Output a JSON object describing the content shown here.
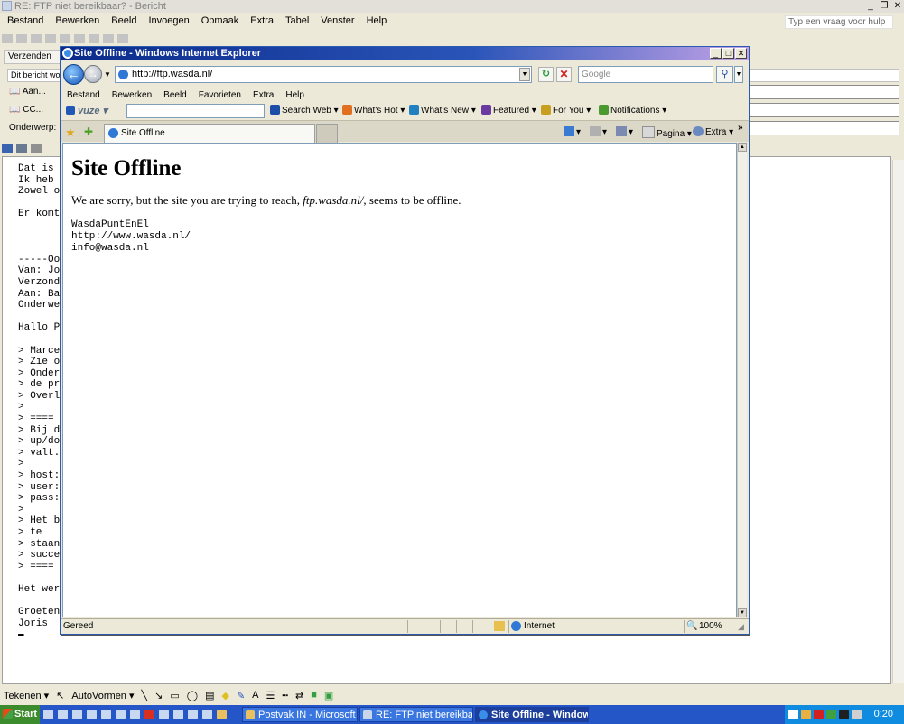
{
  "word": {
    "title": "RE: FTP niet bereikbaar? - Bericht",
    "caption_buttons": [
      "_",
      "❐",
      "✕"
    ],
    "menu": [
      "Bestand",
      "Bewerken",
      "Beeld",
      "Invoegen",
      "Opmaak",
      "Extra",
      "Tabel",
      "Venster",
      "Help"
    ],
    "help_placeholder": "Typ een vraag voor hulp",
    "send_label": "Verzenden",
    "info_text": "Dit bericht wor",
    "to_label": "Aan...",
    "cc_label": "CC...",
    "subject_label": "Onderwerp:",
    "body_lines": [
      "Dat is da",
      "Ik heb he",
      "Zowel op",
      "",
      "Er komt ",
      "",
      "",
      "",
      "-----Oors",
      "Van: Jor",
      "Verzonde",
      "Aan: Bar",
      "Onderwe",
      "",
      "Hallo Pat",
      "",
      "> Marce",
      "> Zie on",
      "> Onder:",
      "> de prij",
      "> Overle",
      ">",
      "> ====",
      "> Bij dez",
      "> up/dov",
      "> valt.",
      ">",
      "> host:",
      "> user: ",
      "> pass:",
      ">",
      "> Het be",
      "> te",
      "> staan.",
      "> succes",
      "> ====",
      "",
      "Het werk",
      "",
      "Groeten,",
      "Joris",
      "▬"
    ],
    "draw_toolbar": {
      "draw_label": "Tekenen ▾",
      "autoshapes_label": "AutoVormen ▾"
    }
  },
  "ie": {
    "title": "Site Offline - Windows Internet Explorer",
    "address": "http://ftp.wasda.nl/",
    "search_placeholder": "Google",
    "menu": [
      "Bestand",
      "Bewerken",
      "Beeld",
      "Favorieten",
      "Extra",
      "Help"
    ],
    "vuze_logo": "vuze",
    "vuze_items": [
      {
        "label": "Search Web",
        "icon": "search-icon",
        "color": "#1c4da8"
      },
      {
        "label": "What's Hot",
        "icon": "fire-icon",
        "color": "#e07020"
      },
      {
        "label": "What's New",
        "icon": "sparkle-icon",
        "color": "#2080c0"
      },
      {
        "label": "Featured",
        "icon": "featured-icon",
        "color": "#6a3aa0"
      },
      {
        "label": "For You",
        "icon": "gift-icon",
        "color": "#c8a020"
      },
      {
        "label": "Notifications",
        "icon": "notification-icon",
        "color": "#4a9a30"
      }
    ],
    "tab_title": "Site Offline",
    "toolbar_page_label": "Pagina",
    "toolbar_extra_label": "Extra",
    "status_text": "Gereed",
    "zone_text": "Internet",
    "zoom_text": "100%"
  },
  "page": {
    "heading": "Site Offline",
    "message_before": "We are sorry, but the site you are trying to reach, ",
    "message_site": "ftp.wasda.nl/",
    "message_after": ", seems to be offline.",
    "contact": "WasdaPuntEnEl\nhttp://www.wasda.nl/\ninfo@wasda.nl"
  },
  "taskbar": {
    "start_label": "Start",
    "tasks": [
      {
        "label": "Postvak IN - Microsoft O...",
        "active": false
      },
      {
        "label": "RE: FTP niet bereikbaar?...",
        "active": false
      },
      {
        "label": "Site Offline - Windows...",
        "active": true
      }
    ],
    "clock": "0:20"
  },
  "colors": {
    "ie_title_start": "#0a2a8a",
    "taskbar": "#2456c8",
    "start_button": "#3c8b2c"
  }
}
